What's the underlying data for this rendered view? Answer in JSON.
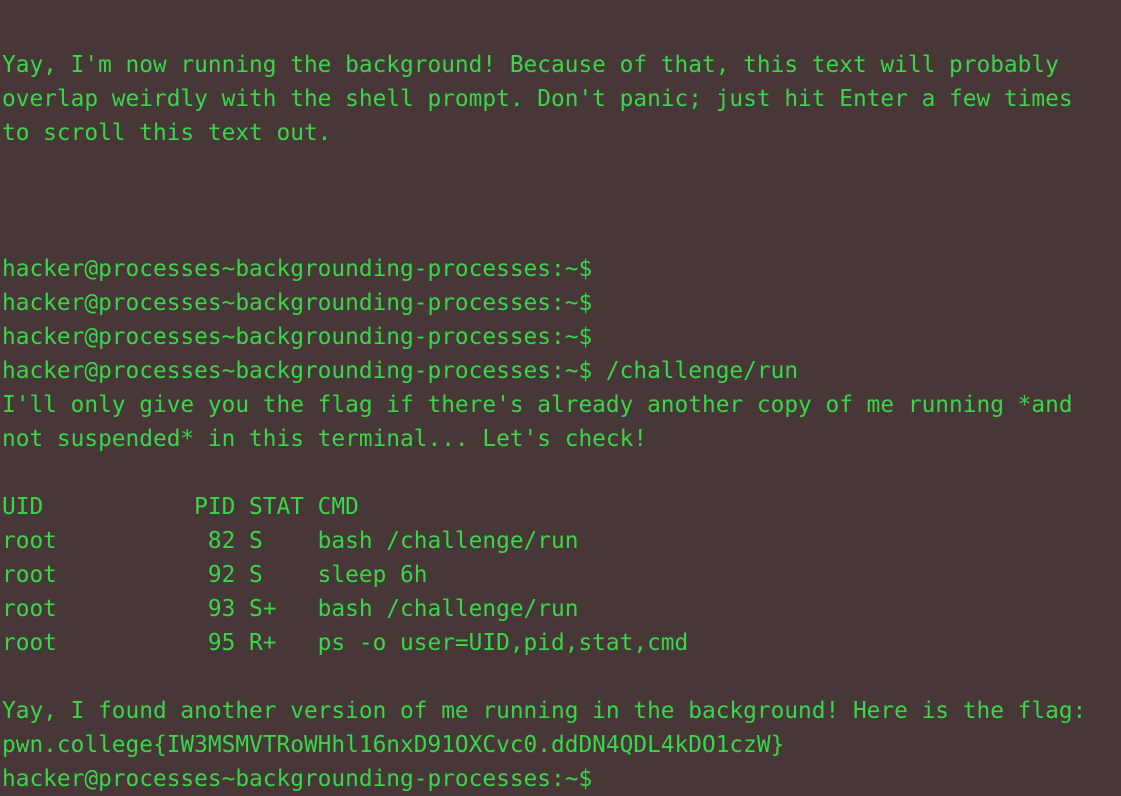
{
  "colors": {
    "background": "#473737",
    "text": "#39d64a"
  },
  "terminal": {
    "lines": [
      "",
      "Yay, I'm now running the background! Because of that, this text will probably",
      "overlap weirdly with the shell prompt. Don't panic; just hit Enter a few times",
      "to scroll this text out.",
      "",
      "",
      "",
      "hacker@processes~backgrounding-processes:~$",
      "hacker@processes~backgrounding-processes:~$",
      "hacker@processes~backgrounding-processes:~$",
      "hacker@processes~backgrounding-processes:~$ /challenge/run",
      "I'll only give you the flag if there's already another copy of me running *and",
      "not suspended* in this terminal... Let's check!",
      "",
      "UID           PID STAT CMD",
      "root           82 S    bash /challenge/run",
      "root           92 S    sleep 6h",
      "root           93 S+   bash /challenge/run",
      "root           95 R+   ps -o user=UID,pid,stat,cmd",
      "",
      "Yay, I found another version of me running in the background! Here is the flag:",
      "pwn.college{IW3MSMVTRoWHhl16nxD91OXCvc0.ddDN4QDL4kDO1czW}",
      "hacker@processes~backgrounding-processes:~$"
    ]
  }
}
